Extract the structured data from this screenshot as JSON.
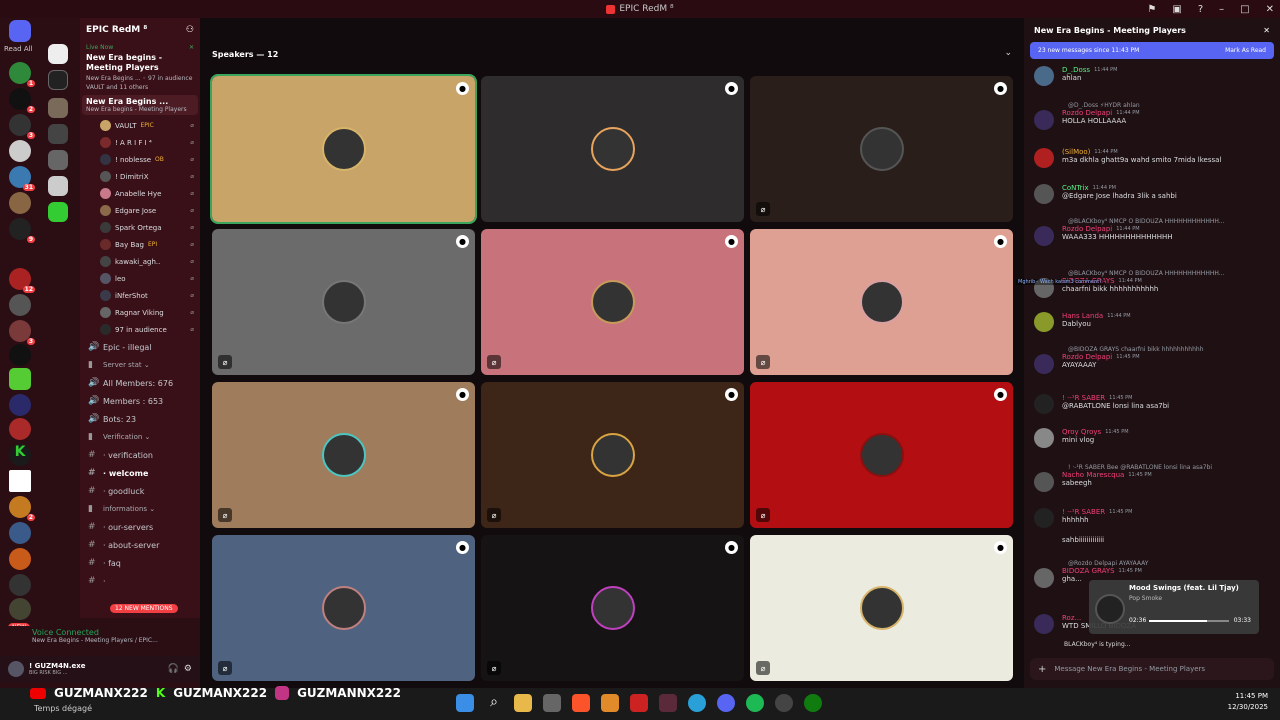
{
  "window": {
    "title": "EPIC RedM ⁸"
  },
  "guilds": {
    "read_all": "Read All",
    "new_label": "NEW"
  },
  "server": {
    "name": "EPIC RedM ⁸",
    "live_now": "Live Now",
    "event_title": "New Era begins - Meeting Players",
    "event_meta": "New Era Begins ... ◦ 97 in audience",
    "event_people": "VAULT and 11 others",
    "voice_channel": {
      "name": "New Era Begins ...",
      "sub": "New Era begins - Meeting Players"
    },
    "members": [
      {
        "name": "VAULT",
        "tag": "EPIC"
      },
      {
        "name": "! A R I F I ⁴",
        "tag": ""
      },
      {
        "name": "! noblesse",
        "tag": "OB"
      },
      {
        "name": "! DimitriX",
        "tag": ""
      },
      {
        "name": "Anabelle Hye",
        "tag": ""
      },
      {
        "name": "Edgare Jose",
        "tag": ""
      },
      {
        "name": "Spark Ortega",
        "tag": ""
      },
      {
        "name": "Bay Bag",
        "tag": "EPI"
      },
      {
        "name": "kawaki_agh..",
        "tag": ""
      },
      {
        "name": "leo",
        "tag": ""
      },
      {
        "name": "iNferShot",
        "tag": ""
      },
      {
        "name": "Ragnar Viking",
        "tag": ""
      },
      {
        "name": "97 in audience",
        "tag": ""
      }
    ],
    "channels": [
      {
        "type": "text",
        "label": "Epic - illegal"
      },
      {
        "type": "cat",
        "label": "Server stat ⌄"
      },
      {
        "type": "text",
        "label": "All Members: 676"
      },
      {
        "type": "text",
        "label": "Members : 653"
      },
      {
        "type": "text",
        "label": "Bots: 23"
      },
      {
        "type": "cat",
        "label": "Verification ⌄"
      },
      {
        "type": "hash",
        "label": "· verification"
      },
      {
        "type": "hash",
        "label": "· welcome"
      },
      {
        "type": "hash",
        "label": "· goodluck"
      },
      {
        "type": "cat",
        "label": "informations ⌄"
      },
      {
        "type": "hash",
        "label": "· our-servers"
      },
      {
        "type": "hash",
        "label": "· about-server"
      },
      {
        "type": "hash",
        "label": "· faq"
      },
      {
        "type": "hash",
        "label": "· "
      }
    ],
    "mentions": "12 NEW MENTIONS"
  },
  "voice": {
    "status": "Voice Connected",
    "channel": "New Era Begins - Meeting Players / EPIC..."
  },
  "user": {
    "name": "! GUZM4N.exe",
    "status": "BIG RISK BIG ..."
  },
  "stage": {
    "speakers": "Speakers — 12",
    "tiles": [
      {
        "bg": "#c9a468",
        "selected": true,
        "ring": "#d6b46a",
        "muted": false
      },
      {
        "bg": "#2e2c2d",
        "selected": false,
        "ring": "#e8a45c",
        "muted": false
      },
      {
        "bg": "#2a1e1b",
        "selected": false,
        "ring": "#555",
        "muted": true
      },
      {
        "bg": "#6b6b6b",
        "selected": false,
        "ring": "#777",
        "muted": true
      },
      {
        "bg": "#c8737b",
        "selected": false,
        "ring": "#c89a5a",
        "muted": true
      },
      {
        "bg": "#dea093",
        "selected": false,
        "ring": "#d8a0a0",
        "muted": true
      },
      {
        "bg": "#9f7c5c",
        "selected": false,
        "ring": "#4bc6c0",
        "muted": true
      },
      {
        "bg": "#3d2517",
        "selected": false,
        "ring": "#d9a441",
        "muted": true
      },
      {
        "bg": "#b30e12",
        "selected": false,
        "ring": "#8a1010",
        "muted": true
      },
      {
        "bg": "#4f6381",
        "selected": false,
        "ring": "#c08080",
        "muted": true
      },
      {
        "bg": "#151313",
        "selected": false,
        "ring": "#c040c0",
        "muted": true
      },
      {
        "bg": "#ecebe0",
        "selected": false,
        "ring": "#d6b46a",
        "muted": true
      }
    ]
  },
  "chat": {
    "title": "New Era Begins - Meeting Players",
    "new_messages": "23 new messages since 11:43 PM",
    "mark_read": "Mark As Read",
    "messages": [
      {
        "reply": "",
        "name": "D_.Doss",
        "color": "#57f287",
        "time": "11:44 PM",
        "text": "ahlan",
        "avatar": "#4a6a8a"
      },
      {
        "reply": "@D_.Doss ⚡HYDR  ahlan",
        "name": "Rozdo Delpapi",
        "color": "#f23f7a",
        "time": "11:44 PM",
        "text": "HOLLA HOLLAAAA",
        "avatar": "#3a2a5a"
      },
      {
        "reply": "",
        "name": "(SilMoo)",
        "color": "#f0b232",
        "time": "11:44 PM",
        "text": "m3a dkhla ghatt9a wahd smito 7mida lkessal",
        "avatar": "#b02020"
      },
      {
        "reply": "",
        "name": "CoNTrix",
        "color": "#57f287",
        "time": "11:44 PM",
        "text": "@Edgare Jose lhadra 3lik a sahbi",
        "avatar": "#555"
      },
      {
        "reply": "@BLACKboy⁴ NMCP  O BIDOUZA HHHHHHHHHHHH...",
        "name": "Rozdo Delpapi",
        "color": "#f23f7a",
        "time": "11:44 PM",
        "text": "WAAA333 HHHHHHHHHHHHHH",
        "avatar": "#3a2a5a"
      },
      {
        "reply": "@BLACKboy⁴ NMCP  O BIDOUZA HHHHHHHHHHHH...",
        "name": "BIDOZA GRAYS",
        "color": "#f23f7a",
        "time": "11:44 PM",
        "text": "chaarfni bikk hhhhhhhhhhh",
        "avatar": "#666"
      },
      {
        "reply": "",
        "name": "Hans Landa",
        "color": "#f23f7a",
        "time": "11:44 PM",
        "text": "Dablyou",
        "avatar": "#8a9a2a"
      },
      {
        "reply": "@BIDOZA GRAYS  chaarfni bikk hhhhhhhhhhh",
        "name": "Rozdo Delpapi",
        "color": "#f23f7a",
        "time": "11:45 PM",
        "text": "AYAYAAAY",
        "avatar": "#3a2a5a"
      },
      {
        "reply": "",
        "name": "! ·-¹R SABER",
        "color": "#f23f7a",
        "time": "11:45 PM",
        "text": "@RABATLONE lonsi lina asa7bi",
        "avatar": "#222"
      },
      {
        "reply": "",
        "name": "Qroy Qroys",
        "color": "#f23f7a",
        "time": "11:45 PM",
        "text": "mini vlog",
        "avatar": "#888"
      },
      {
        "reply": "! ·-¹R SABER  Bee  @RABATLONE lonsi lina asa7bi",
        "name": "Nacho Marescqua",
        "color": "#f23f7a",
        "time": "11:45 PM",
        "text": "sabeegh",
        "avatar": "#555"
      },
      {
        "reply": "",
        "name": "! ·-¹R SABER",
        "color": "#f23f7a",
        "time": "11:45 PM",
        "text": "hhhhhh",
        "avatar": "#222"
      },
      {
        "reply": "",
        "name": "",
        "color": "#f23f7a",
        "time": "",
        "text": "sahbiiiiiiiiiiiii",
        "avatar": ""
      },
      {
        "reply": "@Rozdo Delpapi AYAYAAAY",
        "name": "BIDOZA GRAYS",
        "color": "#f23f7a",
        "time": "11:45 PM",
        "text": "gha...",
        "avatar": "#666"
      },
      {
        "reply": "",
        "name": "Roz...",
        "color": "#f23f7a",
        "time": "",
        "text": "WTD SMILLO BIDOZA",
        "avatar": "#3a2a5a"
      }
    ],
    "typing": "BLACKboy⁴ is typing...",
    "input_placeholder": "Message New Era Begins - Meeting Players",
    "overlay_note": "Mghrib·· Wach katsm3 comment?"
  },
  "music": {
    "title": "Mood Swings (feat. Lil Tjay)",
    "artist": "Pop Smoke",
    "elapsed": "02:36",
    "total": "03:33",
    "progress": 0.73
  },
  "taskbar": {
    "overlay": [
      "GUZMANX222",
      "GUZMANX222",
      "GUZMANNX222"
    ],
    "weather": "Temps dégagé",
    "time": "11:45 PM",
    "date": "12/30/2025"
  }
}
